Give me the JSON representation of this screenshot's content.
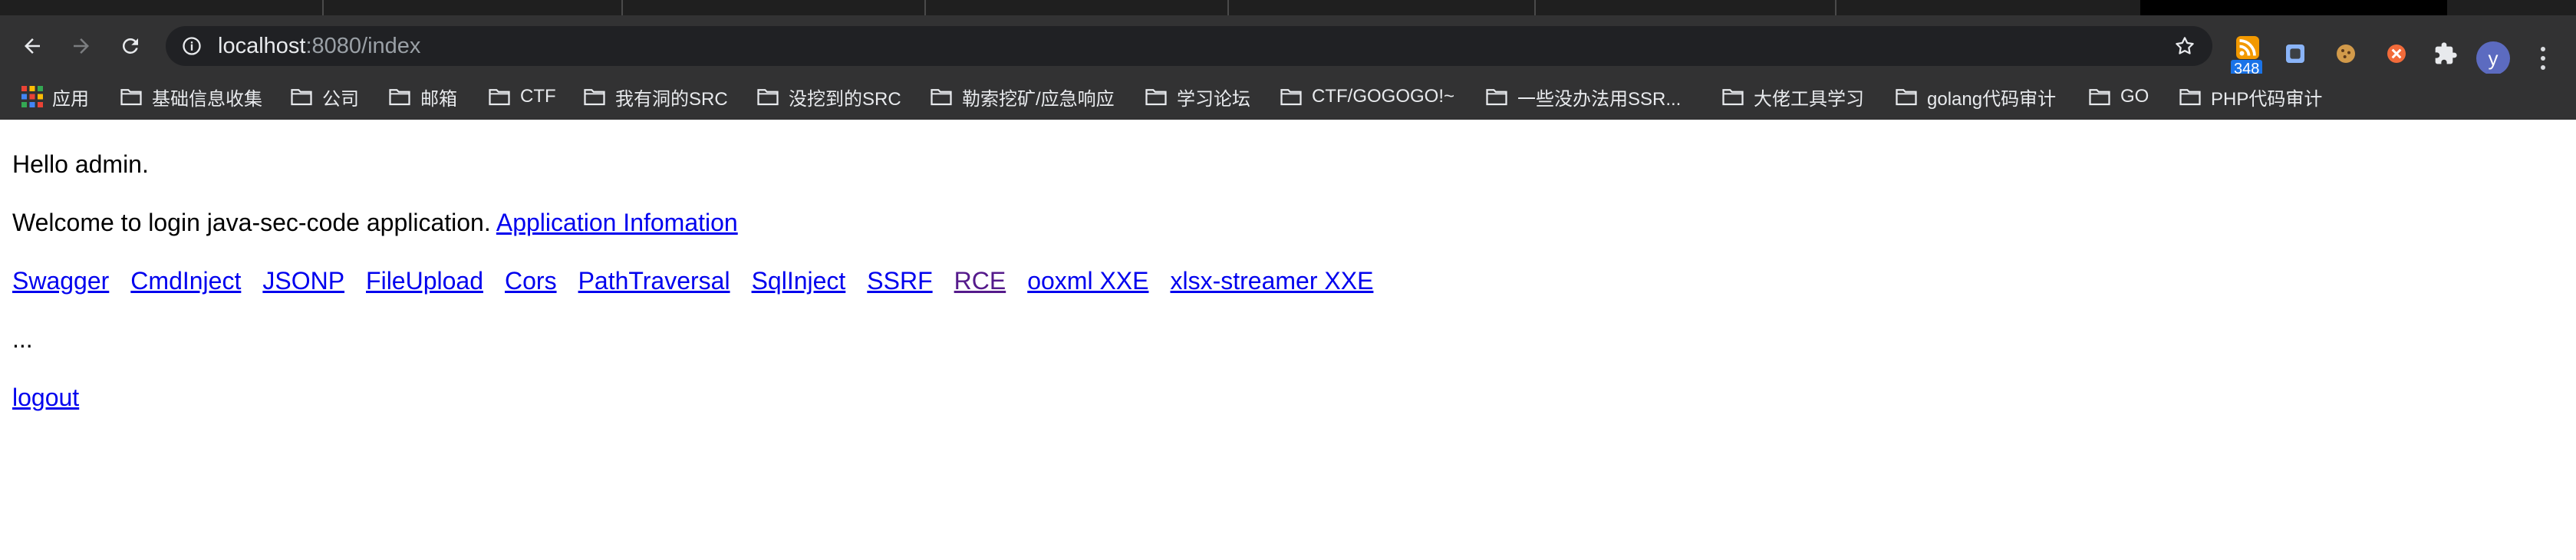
{
  "browser": {
    "url_host": "localhost",
    "url_path": ":8080/index",
    "extension_badge": "348",
    "avatar_letter": "y",
    "icons": [
      "back-icon",
      "forward-icon",
      "reload-icon",
      "info-icon",
      "star-icon",
      "rss-icon",
      "puzzle-icon"
    ]
  },
  "bookmarks": [
    {
      "label": "应用",
      "icon": "apps-grid-icon"
    },
    {
      "label": "基础信息收集",
      "icon": "folder-icon"
    },
    {
      "label": "公司",
      "icon": "folder-icon"
    },
    {
      "label": "邮箱",
      "icon": "folder-icon"
    },
    {
      "label": "CTF",
      "icon": "folder-icon"
    },
    {
      "label": "我有洞的SRC",
      "icon": "folder-icon"
    },
    {
      "label": "没挖到的SRC",
      "icon": "folder-icon"
    },
    {
      "label": "勒索挖矿/应急响应",
      "icon": "folder-icon"
    },
    {
      "label": "学习论坛",
      "icon": "folder-icon"
    },
    {
      "label": "CTF/GOGOGO!~",
      "icon": "folder-icon"
    },
    {
      "label": "一些没办法用SSR...",
      "icon": "folder-icon"
    },
    {
      "label": "大佬工具学习",
      "icon": "folder-icon"
    },
    {
      "label": "golang代码审计",
      "icon": "folder-icon"
    },
    {
      "label": "GO",
      "icon": "folder-icon"
    },
    {
      "label": "PHP代码审计",
      "icon": "folder-icon"
    }
  ],
  "page": {
    "greeting": "Hello admin.",
    "welcome_text": "Welcome to login java-sec-code application.",
    "app_info_link": "Application Infomation",
    "links": [
      "Swagger",
      "CmdInject",
      "JSONP",
      "FileUpload",
      "Cors",
      "PathTraversal",
      "SqlInject",
      "SSRF",
      "RCE",
      "ooxml XXE",
      "xlsx-streamer XXE"
    ],
    "ellipsis": "...",
    "logout": "logout"
  },
  "colors": {
    "link": "#0000ee",
    "visited_link": "#551a8b",
    "toolbar_bg": "#323233"
  }
}
